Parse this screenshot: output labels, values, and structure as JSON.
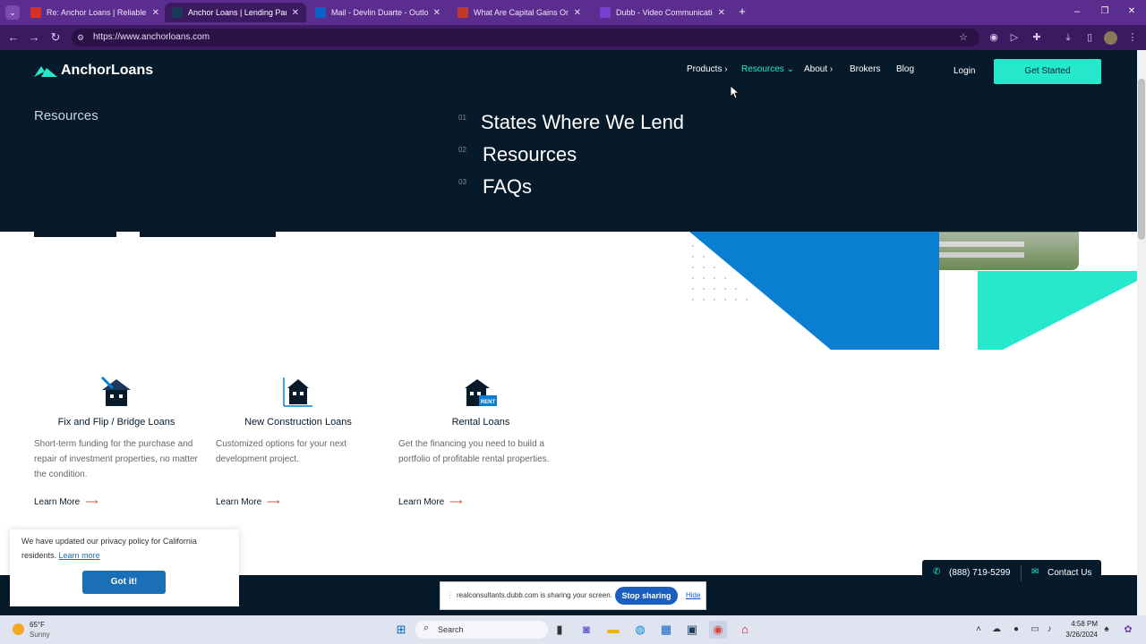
{
  "browser": {
    "tabs": [
      {
        "title": "Re: Anchor Loans | Reliable Rea",
        "color": "#d93025",
        "active": false
      },
      {
        "title": "Anchor Loans | Lending Partne",
        "color": "#1a3a5c",
        "active": true
      },
      {
        "title": "Mail - Devlin Duarte - Outlook",
        "color": "#0a64c8",
        "active": false
      },
      {
        "title": "What Are Capital Gains On Ren",
        "color": "#c0392b",
        "active": false
      },
      {
        "title": "Dubb - Video Communicatio",
        "color": "#7b3fd6",
        "active": false
      }
    ],
    "url": "https://www.anchorloans.com",
    "new_tab": "+",
    "close_glyph": "✕"
  },
  "site": {
    "logo_text": "AnchorLoans",
    "nav": {
      "products": "Products",
      "resources": "Resources",
      "about": "About",
      "brokers": "Brokers",
      "blog": "Blog",
      "login": "Login",
      "get_started": "Get Started"
    },
    "mega_menu": {
      "heading": "Resources",
      "items": [
        {
          "num": "01",
          "label": "States Where We Lend"
        },
        {
          "num": "02",
          "label": "Resources"
        },
        {
          "num": "03",
          "label": "FAQs"
        }
      ]
    },
    "products": [
      {
        "title": "Fix and Flip / Bridge Loans",
        "desc": "Short-term funding for the purchase and repair of investment properties, no matter the condition.",
        "cta": "Learn More"
      },
      {
        "title": "New Construction Loans",
        "desc": "Customized options for your next development project.",
        "cta": "Learn More"
      },
      {
        "title": "Rental Loans",
        "desc": "Get the financing you need to build a portfolio of profitable rental properties.",
        "cta": "Learn More"
      }
    ],
    "rent_badge": "RENT",
    "cookie": {
      "text": "We have updated our privacy policy for California residents.",
      "link": "Learn more",
      "button": "Got it!"
    },
    "contact": {
      "phone": "(888) 719-5299",
      "contact_us": "Contact Us"
    },
    "colors": {
      "navy": "#071a2a",
      "teal": "#26e8cd",
      "blue": "#0a7fd1"
    }
  },
  "share_bar": {
    "text": "realconsultants.dubb.com is sharing your screen.",
    "stop": "Stop sharing",
    "hide": "Hide"
  },
  "taskbar": {
    "weather_temp": "65°F",
    "weather_desc": "Sunny",
    "search": "Search",
    "time": "4:58 PM",
    "date": "3/26/2024"
  }
}
